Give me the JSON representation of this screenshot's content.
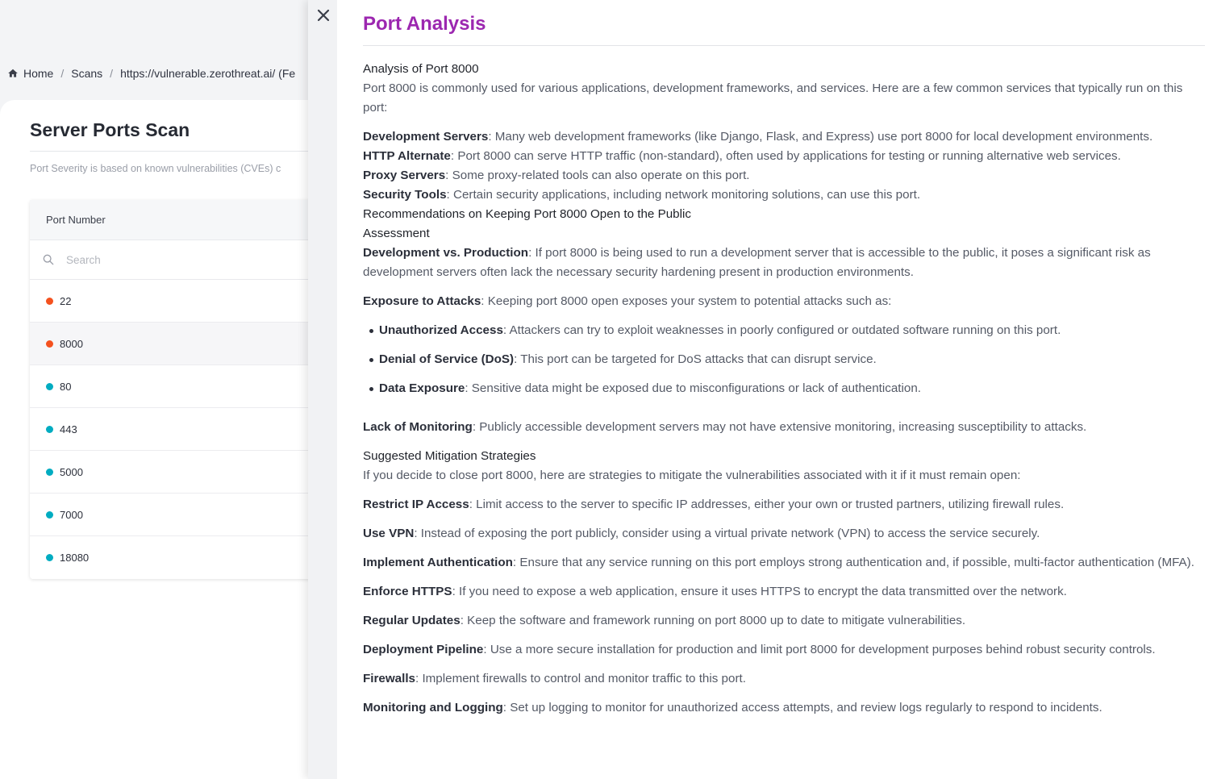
{
  "breadcrumb": {
    "home": "Home",
    "scans": "Scans",
    "target": "https://vulnerable.zerothreat.ai/ (Fe"
  },
  "panel": {
    "title": "Server Ports Scan",
    "note": "Port Severity is based on known vulnerabilities (CVEs) c",
    "column_header": "Port Number",
    "search_placeholder": "Search",
    "ports": [
      {
        "number": "22",
        "severity_color": "#f4511e"
      },
      {
        "number": "8000",
        "severity_color": "#f4511e"
      },
      {
        "number": "80",
        "severity_color": "#00acc1"
      },
      {
        "number": "443",
        "severity_color": "#00acc1"
      },
      {
        "number": "5000",
        "severity_color": "#00acc1"
      },
      {
        "number": "7000",
        "severity_color": "#00acc1"
      },
      {
        "number": "18080",
        "severity_color": "#00acc1"
      }
    ]
  },
  "drawer": {
    "title": "Port Analysis",
    "analysis_heading": "Analysis of Port 8000",
    "analysis_intro": "Port 8000 is commonly used for various applications, development frameworks, and services. Here are a few common services that typically run on this port:",
    "services": [
      {
        "term": "Development Servers",
        "text": ": Many web development frameworks (like Django, Flask, and Express) use port 8000 for local development environments."
      },
      {
        "term": "HTTP Alternate",
        "text": ": Port 8000 can serve HTTP traffic (non-standard), often used by applications for testing or running alternative web services."
      },
      {
        "term": "Proxy Servers",
        "text": ": Some proxy-related tools can also operate on this port."
      },
      {
        "term": "Security Tools",
        "text": ": Certain security applications, including network monitoring solutions, can use this port."
      }
    ],
    "recommendations_heading_1": "Recommendations on Keeping Port 8000 Open to the Public",
    "recommendations_heading_2": "Assessment",
    "dev_vs_prod": {
      "term": "Development vs. Production",
      "text": ": If port 8000 is being used to run a development server that is accessible to the public, it poses a significant risk as development servers often lack the necessary security hardening present in production environments."
    },
    "exposure": {
      "term": "Exposure to Attacks",
      "text": ": Keeping port 8000 open exposes your system to potential attacks such as:"
    },
    "attacks": [
      {
        "term": "Unauthorized Access",
        "text": ": Attackers can try to exploit weaknesses in poorly configured or outdated software running on this port."
      },
      {
        "term": "Denial of Service (DoS)",
        "text": ": This port can be targeted for DoS attacks that can disrupt service."
      },
      {
        "term": "Data Exposure",
        "text": ": Sensitive data might be exposed due to misconfigurations or lack of authentication."
      }
    ],
    "monitoring": {
      "term": "Lack of Monitoring",
      "text": ": Publicly accessible development servers may not have extensive monitoring, increasing susceptibility to attacks."
    },
    "mitigation_heading": "Suggested Mitigation Strategies",
    "mitigation_intro": "If you decide to close port 8000, here are strategies to mitigate the vulnerabilities associated with it if it must remain open:",
    "mitigations": [
      {
        "term": "Restrict IP Access",
        "text": ": Limit access to the server to specific IP addresses, either your own or trusted partners, utilizing firewall rules."
      },
      {
        "term": "Use VPN",
        "text": ": Instead of exposing the port publicly, consider using a virtual private network (VPN) to access the service securely."
      },
      {
        "term": "Implement Authentication",
        "text": ": Ensure that any service running on this port employs strong authentication and, if possible, multi-factor authentication (MFA)."
      },
      {
        "term": "Enforce HTTPS",
        "text": ": If you need to expose a web application, ensure it uses HTTPS to encrypt the data transmitted over the network."
      },
      {
        "term": "Regular Updates",
        "text": ": Keep the software and framework running on port 8000 up to date to mitigate vulnerabilities."
      },
      {
        "term": "Deployment Pipeline",
        "text": ": Use a more secure installation for production and limit port 8000 for development purposes behind robust security controls."
      },
      {
        "term": "Firewalls",
        "text": ": Implement firewalls to control and monitor traffic to this port."
      },
      {
        "term": "Monitoring and Logging",
        "text": ": Set up logging to monitor for unauthorized access attempts, and review logs regularly to respond to incidents."
      }
    ]
  }
}
